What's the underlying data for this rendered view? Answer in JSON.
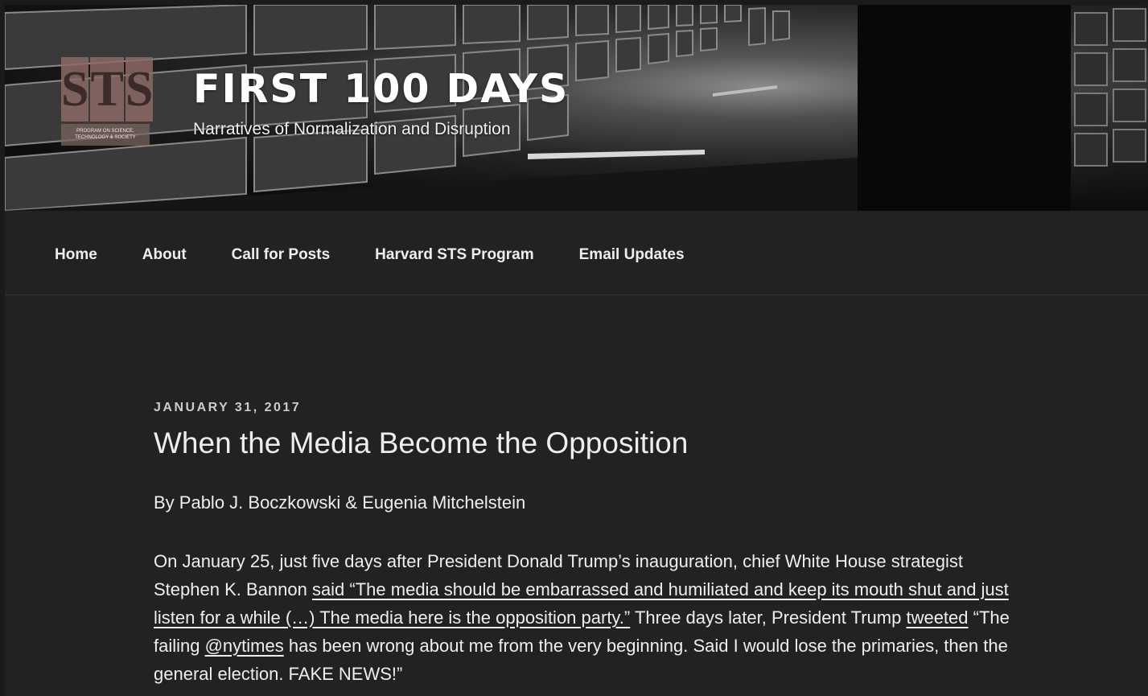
{
  "site": {
    "title": "FIRST 100 DAYS",
    "tagline": "Narratives of Normalization and Disruption",
    "logo": {
      "letters": [
        "S",
        "T",
        "S"
      ],
      "caption_line1": "PROGRAM ON SCIENCE,",
      "caption_line2": "TECHNOLOGY & SOCIETY"
    }
  },
  "nav": {
    "items": [
      {
        "label": "Home"
      },
      {
        "label": "About"
      },
      {
        "label": "Call for Posts"
      },
      {
        "label": "Harvard STS Program"
      },
      {
        "label": "Email Updates"
      }
    ]
  },
  "post": {
    "date": "JANUARY 31, 2017",
    "title": "When the Media Become the Opposition",
    "byline": "By Pablo J. Boczkowski & Eugenia Mitchelstein",
    "p1": {
      "t1": "On January 25, just five days after President Donald Trump’s inauguration, chief White House strategist Stephen K. Bannon ",
      "link1": "said “The media should be embarrassed and humiliated and keep its mouth shut and just listen for a while (…) The media here is the opposition party.”",
      "t2": " Three days later, President Trump ",
      "link2": "tweeted",
      "t3": " “The failing ",
      "link3": "@nytimes",
      "t4": " has been wrong about me from the very beginning. Said I would lose the primaries, then the general election. FAKE NEWS!”"
    }
  },
  "colors": {
    "page_background": "#222222",
    "text": "#eeeeee",
    "meta_text": "#cccccc",
    "logo_accent": "#8c6964"
  }
}
